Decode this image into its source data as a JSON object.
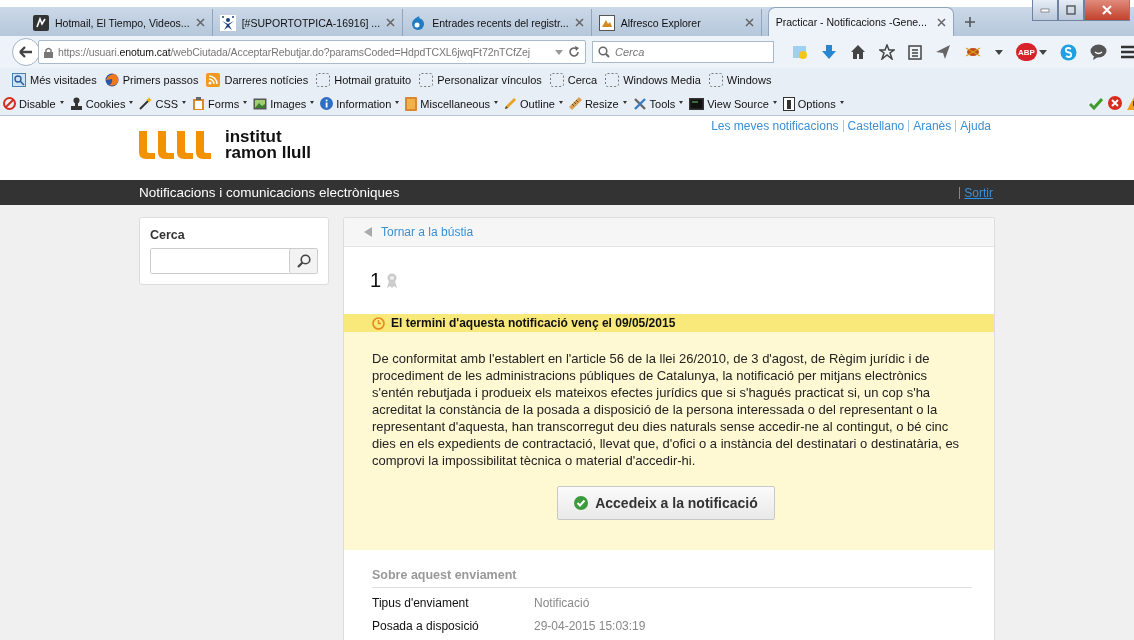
{
  "browser": {
    "tabs": [
      {
        "title": "Hotmail, El Tiempo, Videos...",
        "selected": false
      },
      {
        "title": "[#SUPORTOTPICA-16916] ...",
        "selected": false
      },
      {
        "title": "Entrades recents del registr...",
        "selected": false
      },
      {
        "title": "Alfresco Explorer",
        "selected": false
      },
      {
        "title": "Practicar - Notificacions -Gene...",
        "selected": true
      }
    ],
    "address": {
      "url": "https://usuari.**enotum.cat**/webCiutada/AcceptarRebutjar.do?paramsCoded=HdpdTCXL6jwqFt72nTCfZej"
    },
    "search": {
      "placeholder": "Cerca"
    },
    "adblock_badge": "ABP",
    "bookmarks": [
      {
        "label": "Més visitades",
        "kind": "places"
      },
      {
        "label": "Primers passos",
        "kind": "globe"
      },
      {
        "label": "Darreres notícies",
        "kind": "feed"
      },
      {
        "label": "Hotmail gratuito",
        "kind": "page"
      },
      {
        "label": "Personalizar vínculos",
        "kind": "page"
      },
      {
        "label": "Cerca",
        "kind": "page"
      },
      {
        "label": "Windows Media",
        "kind": "page"
      },
      {
        "label": "Windows",
        "kind": "page"
      }
    ],
    "dev_toolbar": [
      {
        "label": "Disable"
      },
      {
        "label": "Cookies"
      },
      {
        "label": "CSS"
      },
      {
        "label": "Forms"
      },
      {
        "label": "Images"
      },
      {
        "label": "Information"
      },
      {
        "label": "Miscellaneous"
      },
      {
        "label": "Outline"
      },
      {
        "label": "Resize"
      },
      {
        "label": "Tools"
      },
      {
        "label": "View Source"
      },
      {
        "label": "Options"
      }
    ]
  },
  "page": {
    "logo": {
      "line_1": "institut",
      "line_2": "ramon llull"
    },
    "header_links": [
      "Les meves notificacions",
      "Castellano",
      "Aranès",
      "Ajuda"
    ],
    "bar_title": "Notificacions i comunicacions electròniques",
    "logout": "Sortir",
    "sidebar": {
      "title": "Cerca"
    },
    "back_link": "Tornar a la bústia",
    "notification_number": "1",
    "deadline": "El termini d'aquesta notificació venç el 09/05/2015",
    "notice": "De conformitat amb l'establert en l'article 56 de la llei 26/2010, de 3 d'agost, de Règim jurídic i de procediment de les administracions públiques de Catalunya, la notificació per mitjans electrònics s'entén rebutjada i produeix els mateixos efectes jurídics que si s'hagués practicat si, un cop s'ha acreditat la constància de la posada a disposició de la persona interessada o del representant o la representant d'aquesta, han transcorregut deu dies naturals sense accedir-ne al contingut, o bé cinc dies en els expedients de contractació, llevat que, d'ofici o a instància del destinatari o destinatària, es comprovi la impossibilitat tècnica o material d'accedir-hi.",
    "access_button": "Accedeix a la notificació",
    "details": {
      "title": "Sobre aquest enviament",
      "rows": [
        {
          "label": "Tipus d'enviament",
          "value": "Notificació"
        },
        {
          "label": "Posada a disposició",
          "value": "29-04-2015 15:03:19"
        }
      ]
    }
  }
}
